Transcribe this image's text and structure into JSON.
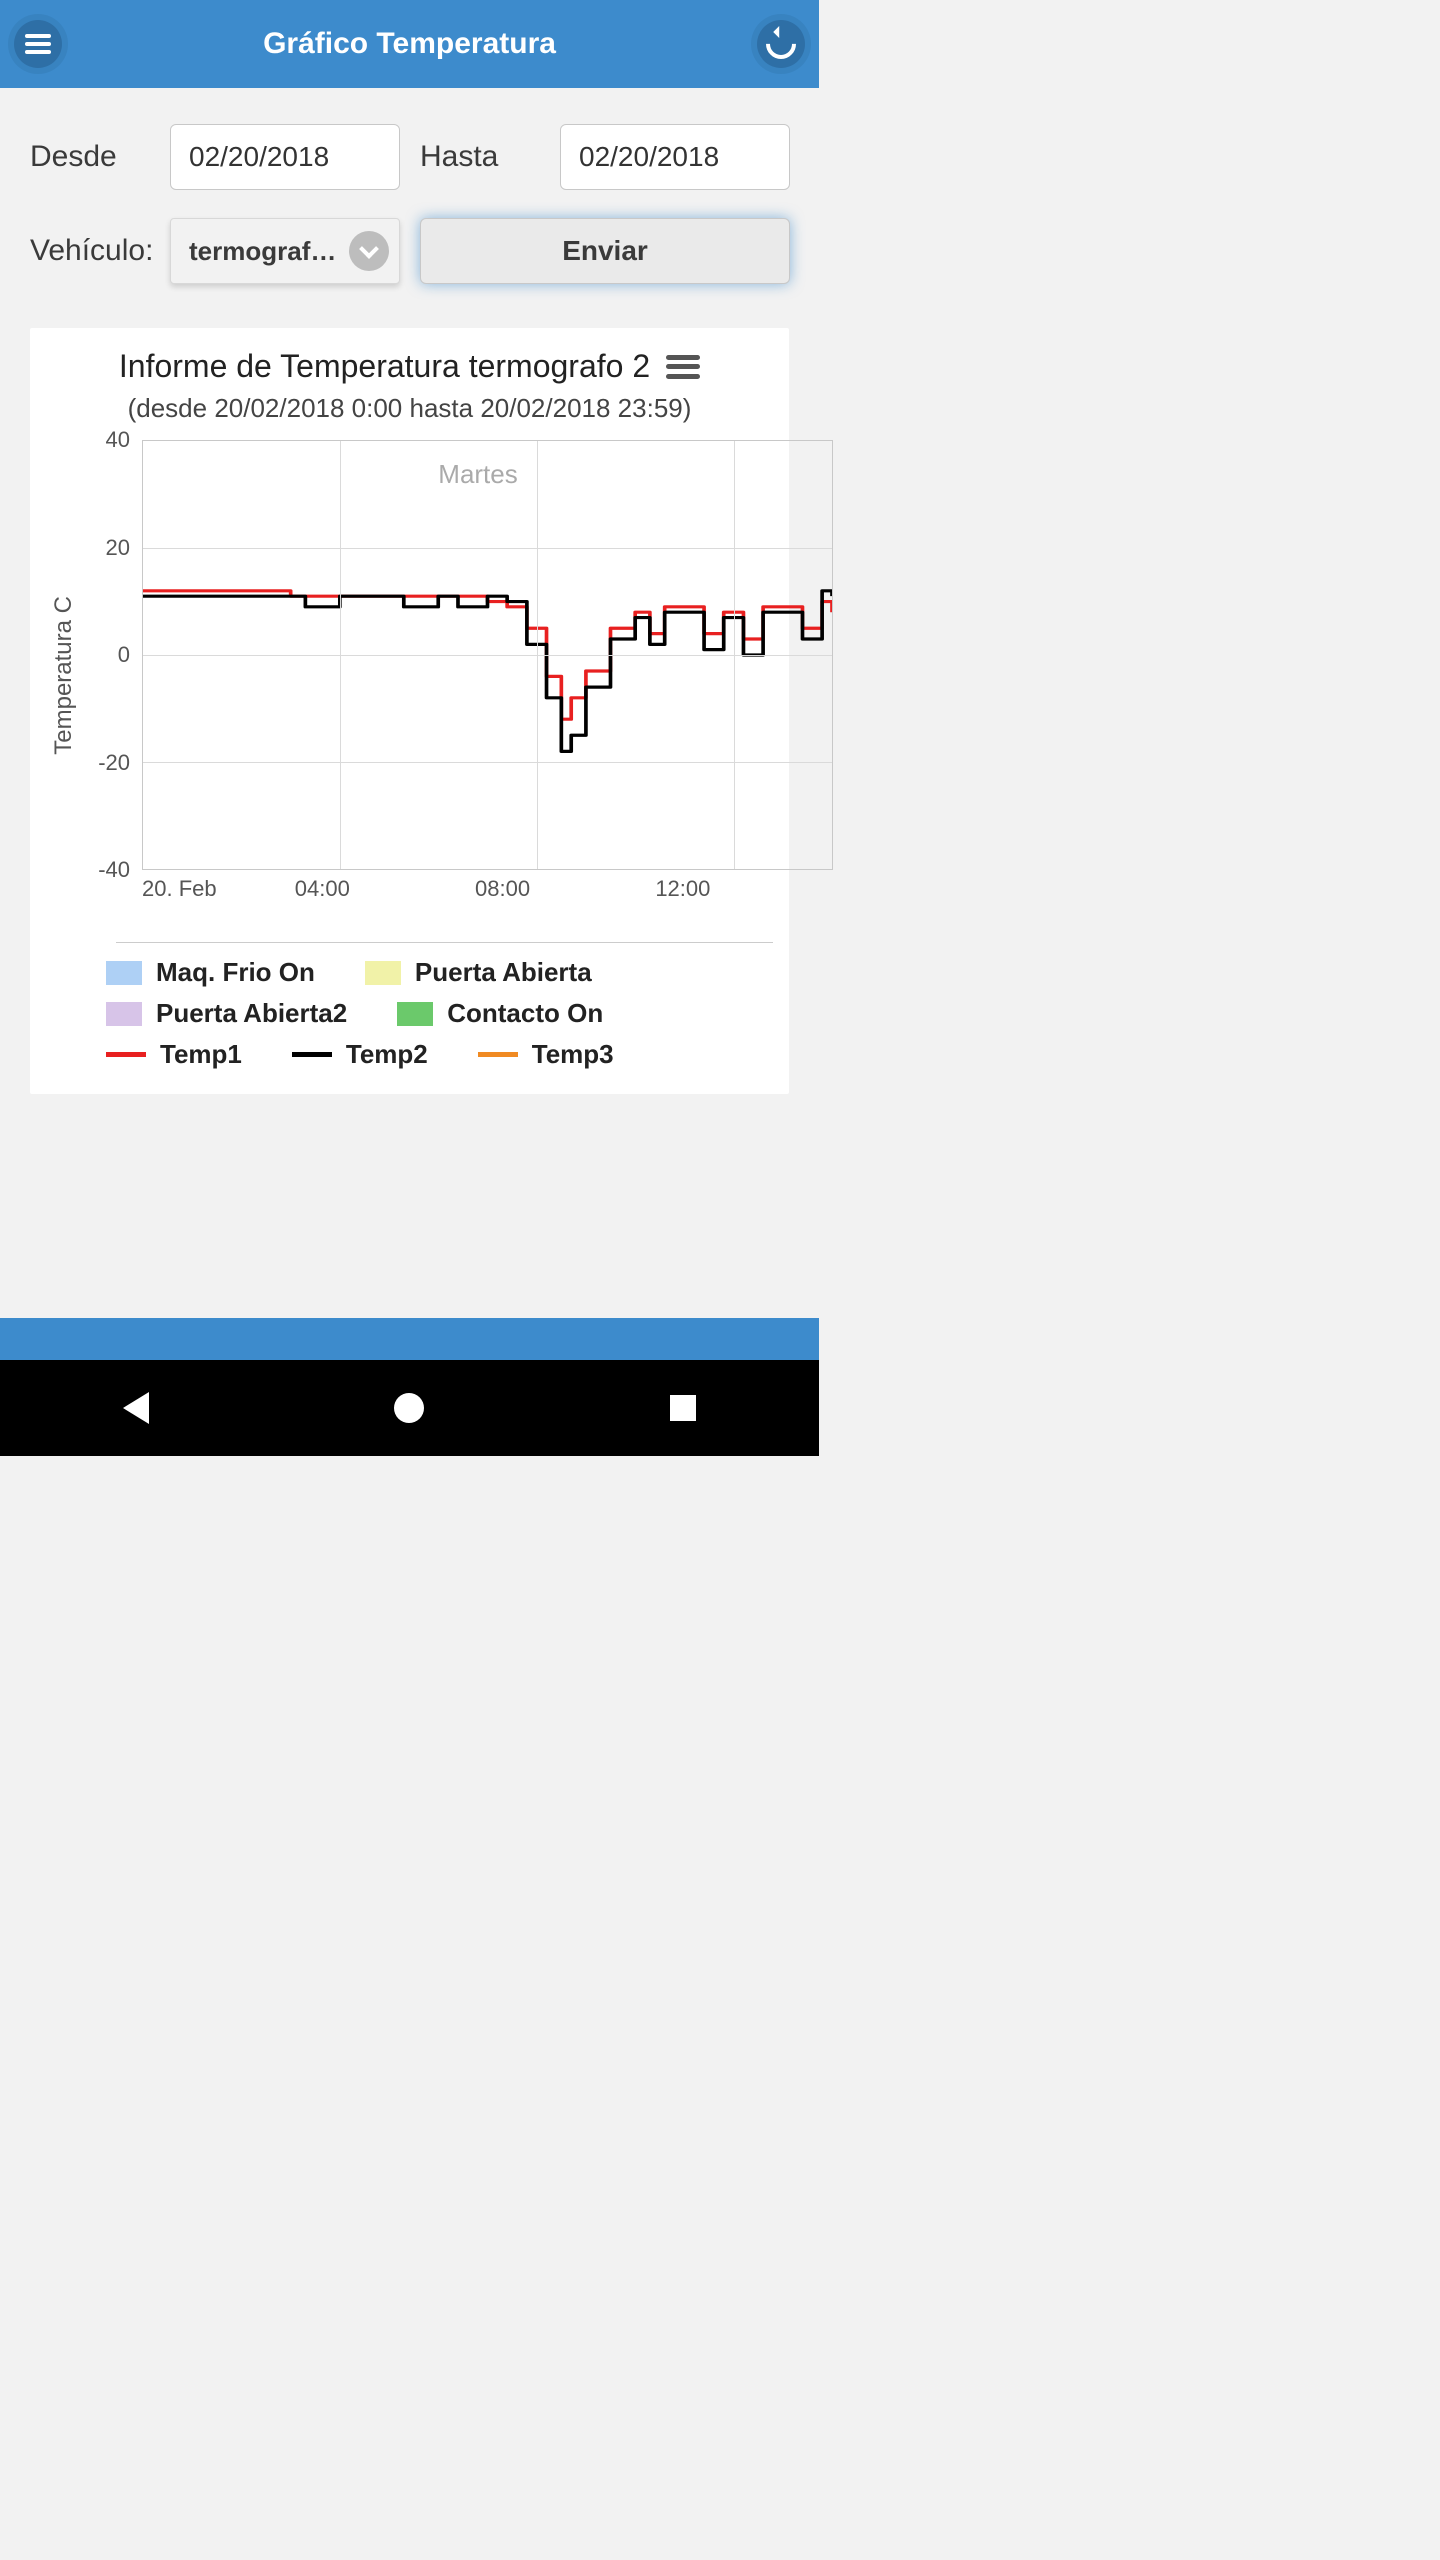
{
  "header": {
    "title": "Gráfico Temperatura"
  },
  "form": {
    "from_label": "Desde",
    "from_value": "02/20/2018",
    "to_label": "Hasta",
    "to_value": "02/20/2018",
    "vehicle_label": "Vehículo:",
    "vehicle_selected": "termograf…",
    "submit_label": "Enviar"
  },
  "chart": {
    "title": "Informe de Temperatura termografo 2",
    "subtitle": "(desde 20/02/2018 0:00 hasta 20/02/2018 23:59)",
    "ylabel": "Temperatura C",
    "day_label": "Martes",
    "y_ticks": [
      "40",
      "20",
      "0",
      "-20",
      "-40"
    ],
    "x_ticks": [
      "20. Feb",
      "04:00",
      "08:00",
      "12:00"
    ]
  },
  "legend": {
    "items": [
      {
        "label": "Maq. Frio On",
        "type": "swatch",
        "color": "#aed0f5"
      },
      {
        "label": "Puerta Abierta",
        "type": "swatch",
        "color": "#f1f2a8"
      },
      {
        "label": "Puerta Abierta2",
        "type": "swatch",
        "color": "#d7c4e8"
      },
      {
        "label": "Contacto On",
        "type": "swatch",
        "color": "#6bc96b"
      },
      {
        "label": "Temp1",
        "type": "line",
        "color": "#e82020"
      },
      {
        "label": "Temp2",
        "type": "line",
        "color": "#000000"
      },
      {
        "label": "Temp3",
        "type": "line",
        "color": "#f08a22"
      }
    ]
  },
  "chart_data": {
    "type": "line",
    "title": "Informe de Temperatura termografo 2",
    "subtitle": "(desde 20/02/2018 0:00 hasta 20/02/2018 23:59)",
    "xlabel": "",
    "ylabel": "Temperatura C",
    "ylim": [
      -40,
      40
    ],
    "x_unit": "hour_of_day",
    "x_range": [
      0,
      14
    ],
    "x_tick_labels": [
      "20. Feb",
      "04:00",
      "08:00",
      "12:00"
    ],
    "day_annotation": "Martes",
    "series": [
      {
        "name": "Temp1",
        "color": "#e82020",
        "x": [
          0,
          1,
          2,
          3,
          4,
          5,
          5.5,
          6,
          6.5,
          7,
          7.4,
          7.8,
          8.2,
          8.5,
          8.7,
          9,
          9.5,
          10,
          10.3,
          10.6,
          11,
          11.4,
          11.8,
          12.2,
          12.6,
          13,
          13.4,
          13.8,
          14
        ],
        "y": [
          12,
          12,
          12,
          11,
          11,
          11,
          11,
          11,
          11,
          10,
          9,
          5,
          -4,
          -12,
          -8,
          -3,
          5,
          8,
          4,
          9,
          9,
          4,
          8,
          3,
          9,
          9,
          5,
          10,
          8
        ]
      },
      {
        "name": "Temp2",
        "color": "#000000",
        "x": [
          0,
          1,
          2,
          3,
          3.3,
          4,
          5,
          5.3,
          6,
          6.4,
          7,
          7.4,
          7.8,
          8.2,
          8.5,
          8.7,
          9,
          9.5,
          10,
          10.3,
          10.6,
          11,
          11.4,
          11.8,
          12.2,
          12.6,
          13,
          13.4,
          13.8,
          14
        ],
        "y": [
          11,
          11,
          11,
          11,
          9,
          11,
          11,
          9,
          11,
          9,
          11,
          10,
          2,
          -8,
          -18,
          -15,
          -6,
          3,
          7,
          2,
          8,
          8,
          1,
          7,
          0,
          8,
          8,
          3,
          12,
          11
        ]
      },
      {
        "name": "Temp3",
        "color": "#f08a22",
        "x": [],
        "y": []
      }
    ],
    "state_bands": [
      {
        "name": "Maq. Frio On",
        "color": "#aed0f5"
      },
      {
        "name": "Puerta Abierta",
        "color": "#f1f2a8"
      },
      {
        "name": "Puerta Abierta2",
        "color": "#d7c4e8"
      },
      {
        "name": "Contacto On",
        "color": "#6bc96b"
      }
    ]
  }
}
